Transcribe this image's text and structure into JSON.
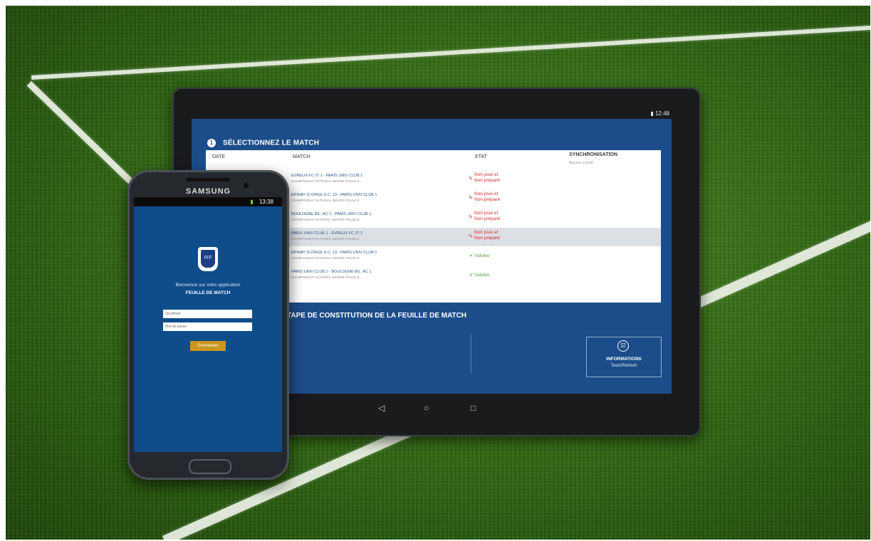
{
  "tablet": {
    "status_time": "12:48",
    "step1_title": "SÉLECTIONNEZ LE MATCH",
    "step1_num": "1",
    "columns": {
      "date": "DATE",
      "match": "MATCH",
      "etat": "ETAT",
      "sync": "SYNCHRONISATION",
      "sync_sub": "Aucune activité"
    },
    "matches": [
      {
        "title": "EVREUX FC 27 1 - PARIS UNIV CLUB 1",
        "sub": "CHAMPIONNAT NATIONAL SENIOR POULE B",
        "status_line1": "Non joué et",
        "status_line2": "Non préparé",
        "status": "pending"
      },
      {
        "title": "EPINAY S/ ORGE S.C. 13 - PARIS UNIV CLUB 1",
        "sub": "CHAMPIONNAT NATIONAL SENIOR POULE B",
        "status_line1": "Non joué et",
        "status_line2": "Non préparé",
        "status": "pending"
      },
      {
        "title": "BOULOGNE BIL. AC 1 - PARIS UNIV CLUB 1",
        "sub": "CHAMPIONNAT NATIONAL SENIOR POULE B",
        "status_line1": "Non joué et",
        "status_line2": "Non préparé",
        "status": "pending"
      },
      {
        "title": "PARIS UNIV CLUB 1 - EVREUX FC 27 1",
        "sub": "CHAMPIONNAT NATIONAL SENIOR POULE B",
        "status_line1": "Non joué et",
        "status_line2": "Non préparé",
        "status": "pending"
      },
      {
        "title": "EPINAY S/ ORGE S.C. 13 - PARIS UNIV CLUB 1",
        "sub": "CHAMPIONNAT NATIONAL SENIOR POULE B",
        "status_line1": "Validée",
        "status_line2": "",
        "status": "ok"
      },
      {
        "title": "PARIS UNIV CLUB 1 - BOULOGNE BIL. AC 1",
        "sub": "CHAMPIONNAT NATIONAL SENIOR POULE B",
        "status_line1": "Validée",
        "status_line2": "",
        "status": "ok"
      }
    ],
    "step2_title": "TAPE DE CONSTITUTION DE LA FEUILLE DE MATCH",
    "info_title": "INFORMATIONS",
    "info_sub": "Tests/Refresh"
  },
  "phone": {
    "brand": "SAMSUNG",
    "status_time": "13:38",
    "logo_text": "FFF",
    "welcome_line1": "Bienvenue sur votre application",
    "welcome_line2": "FEUILLE DE MATCH",
    "identifier_placeholder": "Identifiant",
    "password_placeholder": "Mot de passe",
    "connect_label": "Connexion"
  },
  "colors": {
    "screen_blue": "#1c4d8a",
    "error_red": "#d32f2f",
    "valid_green": "#5aa84a",
    "button_gold": "#c9961e"
  }
}
